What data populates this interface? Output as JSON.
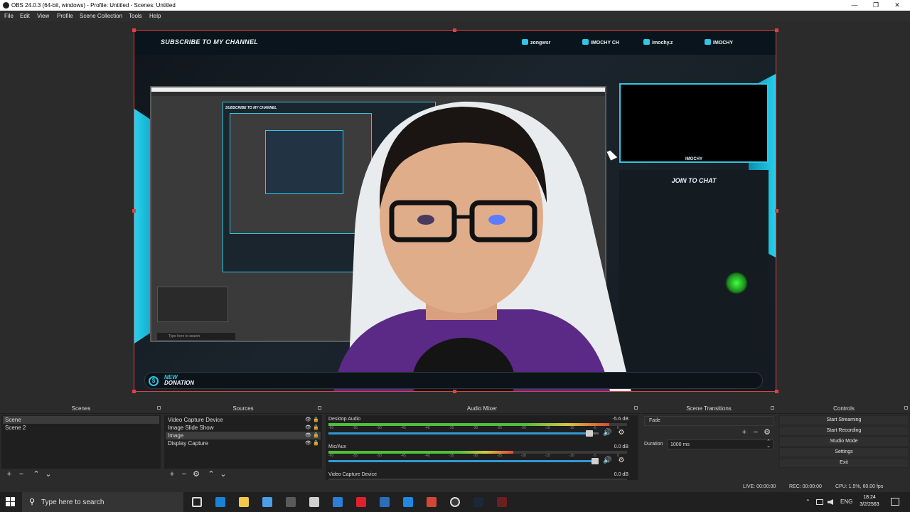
{
  "window": {
    "title": "OBS 24.0.3 (64-bit, windows) - Profile: Untitled - Scenes: Untitled",
    "minimize_glyph": "—",
    "maximize_glyph": "❐",
    "close_glyph": "✕"
  },
  "menu": [
    "File",
    "Edit",
    "View",
    "Profile",
    "Scene Collection",
    "Tools",
    "Help"
  ],
  "preview": {
    "overlay": {
      "subscribe_text": "SUBSCRIBE TO MY CHANNEL",
      "socials": [
        {
          "icon": "twitter-icon",
          "label": "zongwsr"
        },
        {
          "icon": "youtube-icon",
          "label": "IMOCHY CH"
        },
        {
          "icon": "instagram-icon",
          "label": "imochy.z"
        },
        {
          "icon": "facebook-icon",
          "label": "IMOCHY"
        }
      ],
      "cam_name": "IMOCHY",
      "join_chat": "JOIN TO CHAT",
      "new_donation_line1": "NEW",
      "new_donation_line2": "DONATION",
      "donation_icon": "$",
      "nested_subscribe": "SUBSCRIBE TO MY CHANNEL",
      "nested_search": "Type here to search"
    },
    "colors": {
      "accent_cyan": "#2ec7e6",
      "selection_red": "#e04040",
      "shirt_purple": "#5b2a86",
      "razer_green": "#44ff44"
    }
  },
  "docks": {
    "scenes": {
      "title": "Scenes",
      "items": [
        {
          "label": "Scene",
          "selected": true
        },
        {
          "label": "Scene 2",
          "selected": false
        }
      ],
      "footer": [
        "+",
        "−",
        "⌃",
        "⌄"
      ]
    },
    "sources": {
      "title": "Sources",
      "items": [
        {
          "label": "Video Capture Device",
          "selected": false
        },
        {
          "label": "Image Slide Show",
          "selected": false
        },
        {
          "label": "Image",
          "selected": true
        },
        {
          "label": "Display Capture",
          "selected": false
        }
      ],
      "eye_glyph": "👁",
      "lock_glyph": "🔒",
      "footer": [
        "+",
        "−",
        "⚙",
        "⌃",
        "⌄"
      ]
    },
    "audio_mixer": {
      "title": "Audio Mixer",
      "tracks": [
        {
          "name": "Desktop Audio",
          "db": "-5.6 dB",
          "level": 0.94,
          "volume": 0.98
        },
        {
          "name": "Mic/Aux",
          "db": "0.0 dB",
          "level": 0.62,
          "volume": 1.0
        },
        {
          "name": "Video Capture Device",
          "db": "0.0 dB",
          "level": 0.0,
          "volume": 1.0
        }
      ],
      "tick_labels": [
        "-60",
        "-55",
        "-50",
        "-45",
        "-40",
        "-35",
        "-30",
        "-25",
        "-20",
        "-15",
        "-10",
        "-5",
        "0"
      ],
      "speaker_glyph": "🔊",
      "gear_glyph": "⚙"
    },
    "scene_transitions": {
      "title": "Scene Transitions",
      "transition": "Fade",
      "duration_label": "Duration",
      "duration_value": "1000 ms",
      "add_glyph": "+",
      "remove_glyph": "−",
      "gear_glyph": "⚙",
      "up_glyph": "⌃",
      "down_glyph": "⌄"
    },
    "controls": {
      "title": "Controls",
      "buttons": [
        "Start Streaming",
        "Start Recording",
        "Studio Mode",
        "Settings",
        "Exit"
      ]
    }
  },
  "status": {
    "live": "LIVE: 00:00:00",
    "rec": "REC: 00:00:00",
    "cpu": "CPU: 1.5%, 60.00 fps"
  },
  "taskbar": {
    "search_placeholder": "Type here to search",
    "search_glyph": "⚲",
    "lang": "ENG",
    "time": "18:24",
    "date": "3/2/2563",
    "tray_chevron": "⌃",
    "apps": [
      {
        "icon": "task-view-icon",
        "color": "#202020"
      },
      {
        "icon": "edge-icon",
        "color": "#1a82d8"
      },
      {
        "icon": "file-explorer-icon",
        "color": "#f2c84b"
      },
      {
        "icon": "pinned-app-icon",
        "color": "#4aa0e6"
      },
      {
        "icon": "calculator-icon",
        "color": "#5a5a5a"
      },
      {
        "icon": "mail-icon",
        "color": "#d0d0d0"
      },
      {
        "icon": "photos-icon",
        "color": "#2c7fd6"
      },
      {
        "icon": "opera-icon",
        "color": "#e0202a"
      },
      {
        "icon": "editor-icon",
        "color": "#2a6fb8"
      },
      {
        "icon": "browser-icon",
        "color": "#1e88e5"
      },
      {
        "icon": "chrome-icon",
        "color": "#d44638"
      },
      {
        "icon": "obs-icon",
        "color": "#3a3a3a"
      },
      {
        "icon": "steam-icon",
        "color": "#1b2838"
      },
      {
        "icon": "adobe-icon",
        "color": "#6b1f1f"
      }
    ]
  }
}
